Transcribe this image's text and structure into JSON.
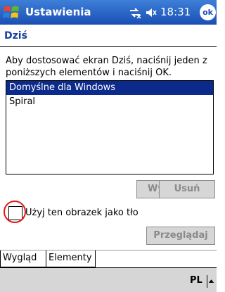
{
  "titlebar": {
    "app_title": "Ustawienia",
    "time": "18:31",
    "ok_label": "ok"
  },
  "page": {
    "heading": "Dziś",
    "instruction": "Aby dostosować ekran Dziś, naciśnij jeden z poniższych elementów i naciśnij OK."
  },
  "list": {
    "items": [
      "Domyślne dla Windows",
      "Spiral"
    ],
    "selected_index": 0
  },
  "buttons": {
    "send": "Wyślij",
    "delete": "Usuń",
    "browse": "Przeglądaj"
  },
  "checkbox": {
    "label": "Użyj ten obrazek jako tło",
    "checked": false
  },
  "tabs": [
    {
      "label": "Wygląd",
      "active": true
    },
    {
      "label": "Elementy",
      "active": false
    }
  ],
  "cmdbar": {
    "input_lang": "PL"
  },
  "colors": {
    "titlebar": "#1a4fb5",
    "heading": "#1c3f9c",
    "selection": "#0c2a8c",
    "annotation": "#e01818"
  },
  "icons": [
    "windows-start-icon",
    "connectivity-icon",
    "volume-icon",
    "ok-icon",
    "sip-arrow-icon"
  ]
}
